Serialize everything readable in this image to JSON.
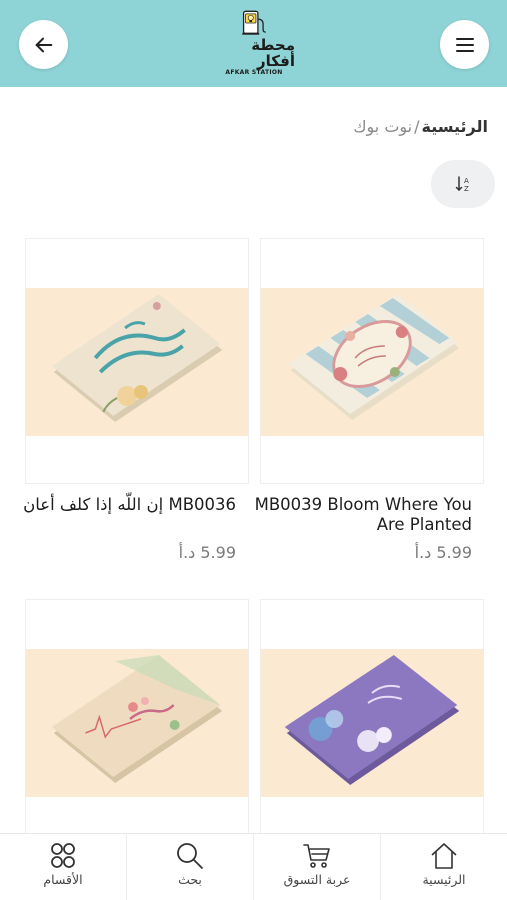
{
  "header": {
    "logo_text": "محطة أفكار",
    "logo_sub": "AFKAR STATION",
    "back_icon": "arrow-left-icon",
    "menu_icon": "hamburger-menu-icon",
    "bg_color": "#8ed3d6"
  },
  "breadcrumb": {
    "home": "الرئيسية",
    "separator": "/",
    "current": "نوت بوك"
  },
  "sort": {
    "icon": "sort-az-icon"
  },
  "products": [
    {
      "name": "MB0039 Bloom Where You Are Planted",
      "price": "5.99 د.أ"
    },
    {
      "name": "MB0036 إن اللّه إذا كلف أعان",
      "price": "5.99 د.أ"
    },
    {
      "name": "",
      "price": ""
    },
    {
      "name": "",
      "price": ""
    }
  ],
  "bottom_nav": [
    {
      "label": "الرئيسية",
      "icon": "home-icon"
    },
    {
      "label": "عربة التسوق",
      "icon": "cart-icon"
    },
    {
      "label": "بحث",
      "icon": "search-icon"
    },
    {
      "label": "الأقسام",
      "icon": "categories-icon"
    }
  ],
  "colors": {
    "accent": "#8ed3d6",
    "image_bg": "#fbe9d2",
    "price": "#7a7a7a"
  }
}
